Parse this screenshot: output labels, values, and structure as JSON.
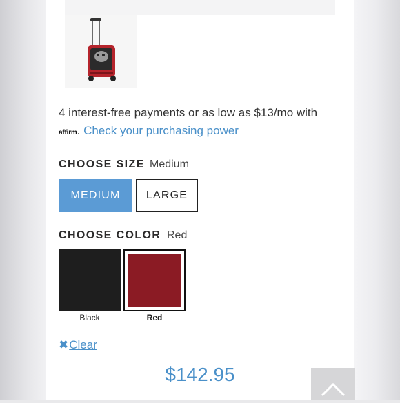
{
  "financing": {
    "text": "4 interest-free payments or as low as $13/mo with",
    "logo": "affirm",
    "separator": ".",
    "link": "Check your purchasing power"
  },
  "size": {
    "label": "CHOOSE SIZE",
    "selected": "Medium",
    "options": [
      "MEDIUM",
      "LARGE"
    ]
  },
  "color": {
    "label": "CHOOSE COLOR",
    "selected": "Red",
    "options": [
      {
        "name": "Black",
        "hex": "#1e1e1e"
      },
      {
        "name": "Red",
        "hex": "#8b1b24"
      }
    ]
  },
  "clear_label": "Clear",
  "price": "$142.95",
  "icons": {
    "clear": "close-icon",
    "back_to_top": "chevron-up-icon",
    "product": "rolling-pet-carrier-image"
  },
  "accent_color": "#4a90c9"
}
